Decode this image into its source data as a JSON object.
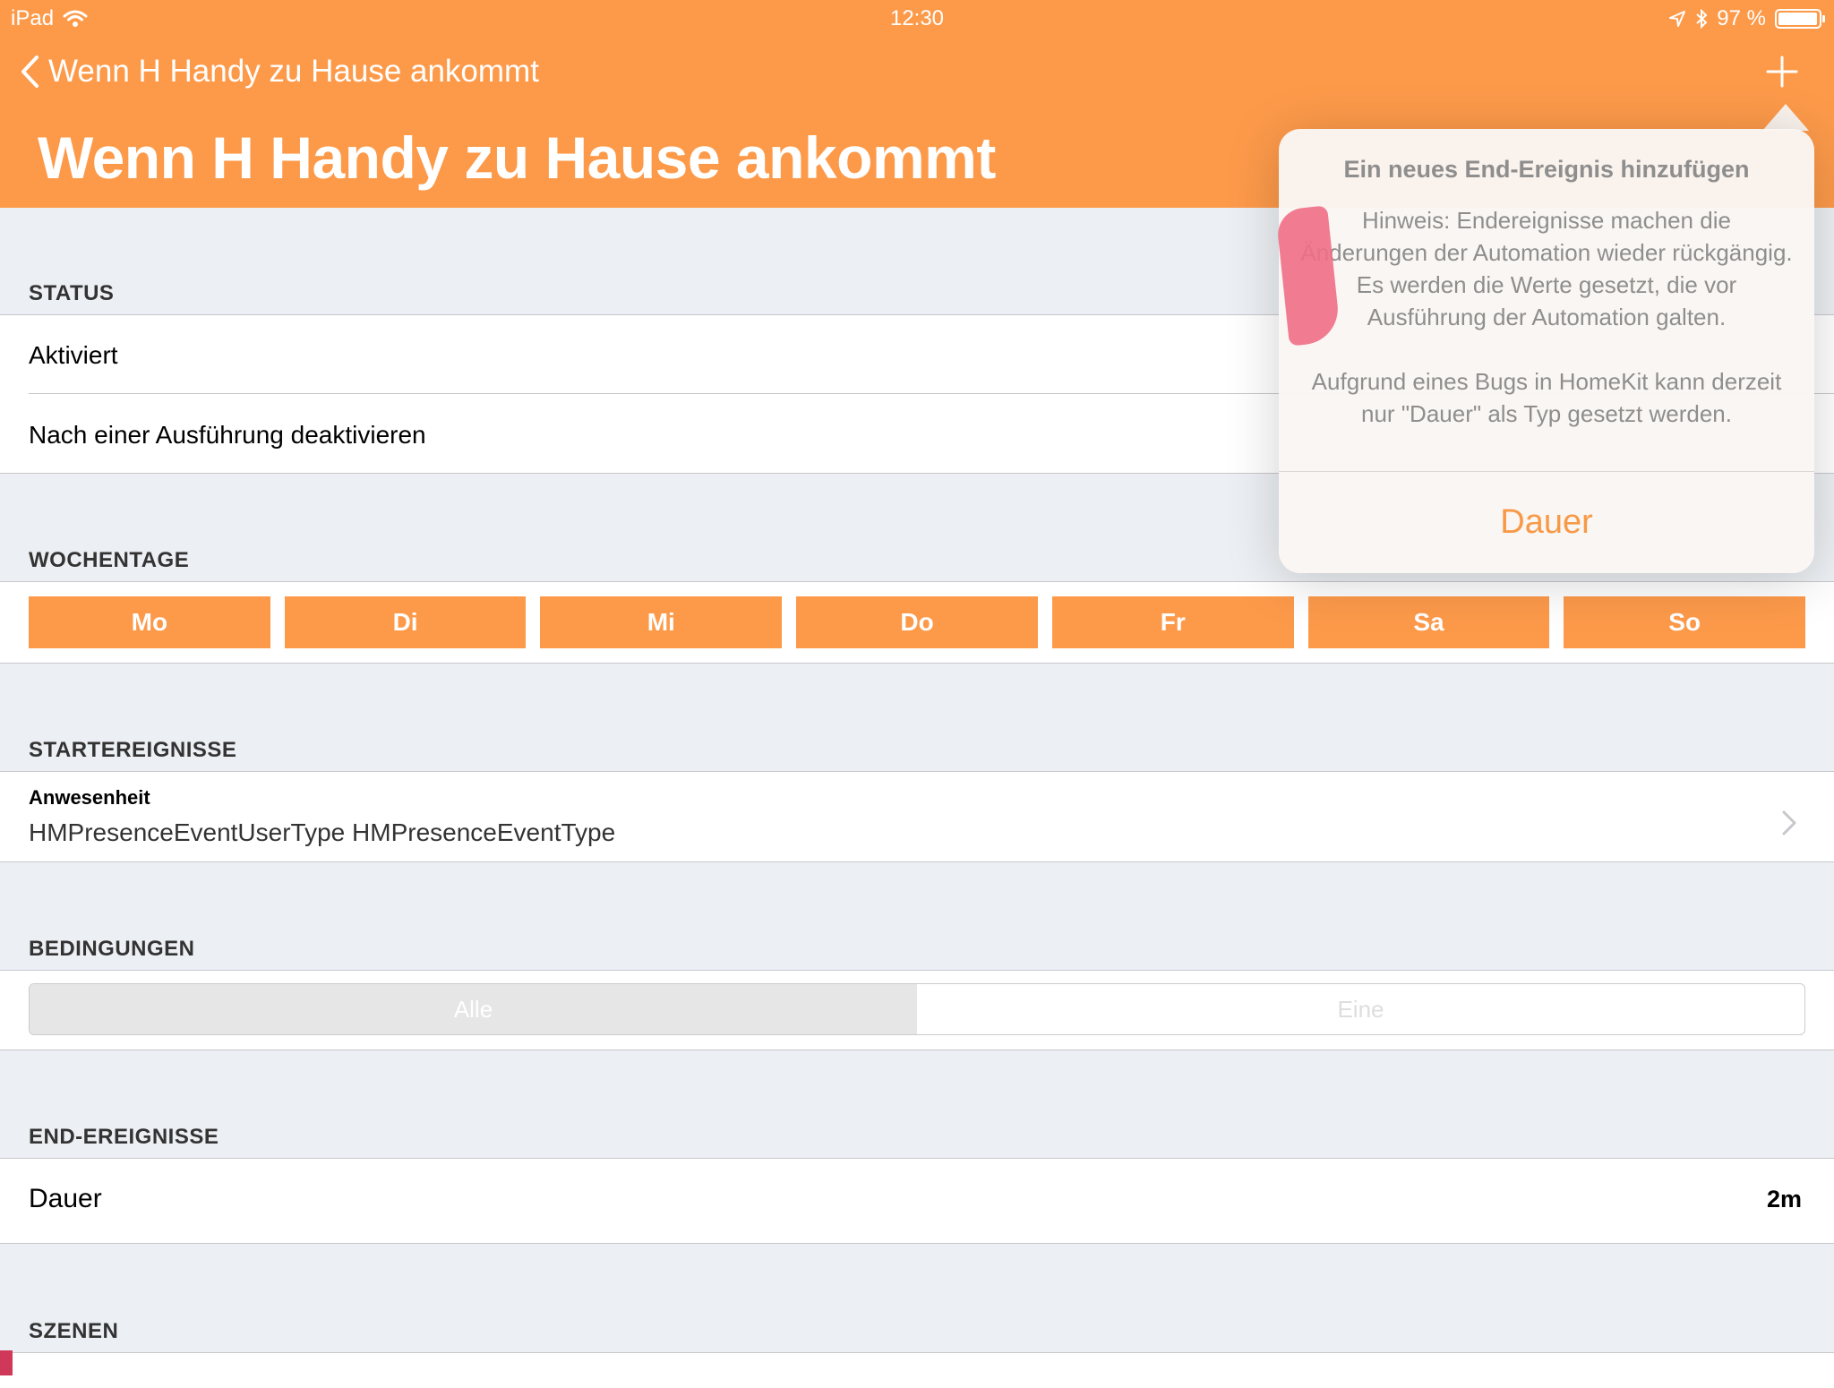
{
  "statusbar": {
    "device": "iPad",
    "time": "12:30",
    "battery": "97 %"
  },
  "nav": {
    "back_label": "Wenn H Handy zu Hause ankommt",
    "title": "Wenn H Handy zu Hause ankommt"
  },
  "sections": {
    "status": {
      "header": "STATUS",
      "rows": [
        "Aktiviert",
        "Nach einer Ausführung deaktivieren"
      ]
    },
    "weekdays": {
      "header": "WOCHENTAGE",
      "days": [
        "Mo",
        "Di",
        "Mi",
        "Do",
        "Fr",
        "Sa",
        "So"
      ]
    },
    "start_events": {
      "header": "STARTEREIGNISSE",
      "item_title": "Anwesenheit",
      "item_subtitle": "HMPresenceEventUserType HMPresenceEventType"
    },
    "conditions": {
      "header": "BEDINGUNGEN",
      "options": [
        "Alle",
        "Eine"
      ],
      "selected": "Alle"
    },
    "end_events": {
      "header": "END-EREIGNISSE",
      "row_label": "Dauer",
      "row_value": "2m"
    },
    "scenes": {
      "header": "SZENEN"
    }
  },
  "popover": {
    "title": "Ein neues End-Ereignis hinzufügen",
    "note_1": "Hinweis: Endereignisse machen die Änderungen der Automation wieder rückgängig. Es werden die Werte gesetzt, die vor Ausführung der Automation galten.",
    "note_2": "Aufgrund eines Bugs in HomeKit kann derzeit nur \"Dauer\" als Typ gesetzt werden.",
    "action": "Dauer"
  },
  "colors": {
    "accent": "#fd9a4a",
    "background": "#eceff3"
  }
}
